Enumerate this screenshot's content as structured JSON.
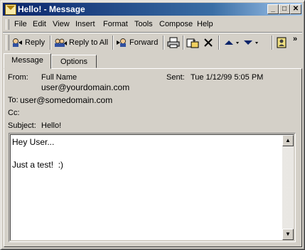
{
  "window": {
    "title": "Hello! - Message"
  },
  "title_buttons": {
    "minimize": "_",
    "maximize": "□",
    "close": "✕"
  },
  "menu": [
    "File",
    "Edit",
    "View",
    "Insert",
    "Format",
    "Tools",
    "Compose",
    "Help"
  ],
  "toolbar": {
    "reply": "Reply",
    "reply_all": "Reply to All",
    "forward": "Forward",
    "more": "»"
  },
  "tabs": [
    "Message",
    "Options"
  ],
  "header": {
    "from_label": "From:",
    "from_name": "Full Name",
    "from_email": "user@yourdomain.com",
    "sent_label": "Sent:",
    "sent_value": "Tue 1/12/99 5:05 PM",
    "to_label": "To:",
    "to_value": "user@somedomain.com",
    "cc_label": "Cc:",
    "subject_label": "Subject:",
    "subject_value": "Hello!"
  },
  "body": {
    "line1": "Hey User...",
    "line2": "Just a test!  :)"
  },
  "colors": {
    "title_start": "#0a246a",
    "title_end": "#a6caf0",
    "face": "#d4d0c8"
  }
}
